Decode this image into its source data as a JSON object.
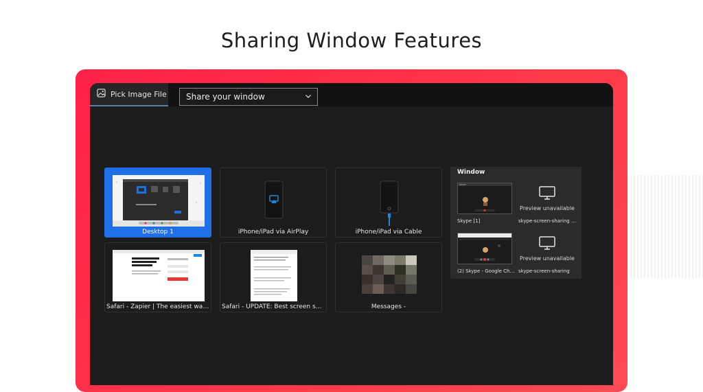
{
  "header": {
    "title": "Sharing Window Features"
  },
  "toolbar": {
    "pick_image_label": "Pick Image File",
    "share_select_value": "Share your window"
  },
  "sources": [
    {
      "label": "Desktop 1",
      "selected": true
    },
    {
      "label": "iPhone/iPad via AirPlay"
    },
    {
      "label": "iPhone/iPad via Cable"
    },
    {
      "label": "Safari - Zapier | The easiest way to..."
    },
    {
      "label": "Safari - UPDATE: Best screen shari..."
    },
    {
      "label": "Messages -"
    }
  ],
  "window_panel": {
    "title": "Window",
    "items": [
      {
        "label": "Skype [1]"
      },
      {
        "label": "skype-screen-sharing - Wo...",
        "status": "Preview unavailable"
      },
      {
        "label": "(2) Skype - Google Chrome"
      },
      {
        "label": "skype-screen-sharing",
        "status": "Preview unavailable"
      }
    ]
  },
  "colors": {
    "frame": "#ff2d4b",
    "selected": "#1f6fe8",
    "window_bg": "#1c1c1c"
  },
  "icons": [
    "image-icon",
    "chevron-down-icon",
    "phone-icon",
    "monitor-icon"
  ]
}
